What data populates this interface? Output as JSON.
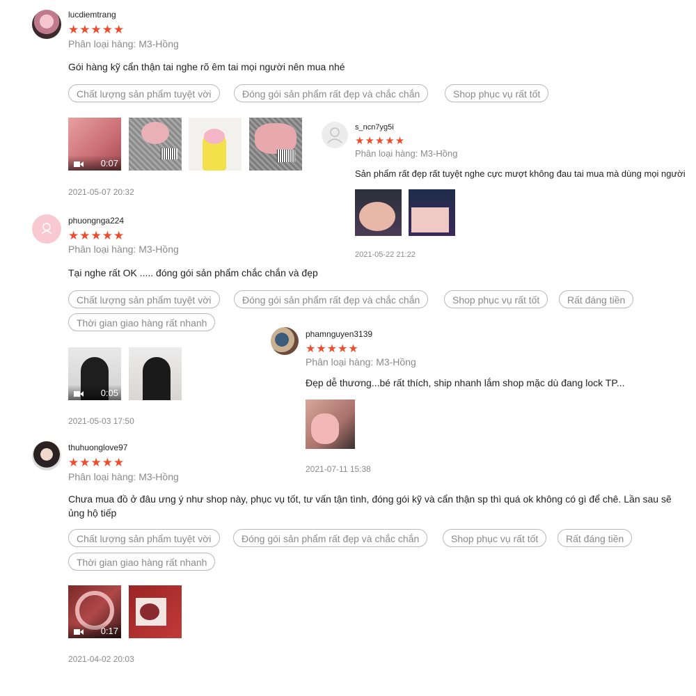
{
  "common": {
    "stars": "★★★★★",
    "star_color": "#ee4d2d"
  },
  "reviews": [
    {
      "username": "lucdiemtrang",
      "variant": "Phân loại hàng: M3-Hồng",
      "comment": "Gói hàng kỹ cẩn thận tai nghe rõ êm tai mọi người nên mua nhé",
      "tags": [
        "Chất lượng sản phẩm tuyệt vời",
        "Đóng gói sản phẩm rất đẹp và chắc chắn",
        "Shop phục vụ rất tốt"
      ],
      "video_duration": "0:07",
      "media_count": 4,
      "date": "2021-05-07 20:32"
    },
    {
      "username": "s_ncn7yg5i",
      "variant": "Phân loại hàng: M3-Hồng",
      "comment": "Sản phẩm rất đẹp rất tuyệt nghe cực mượt không đau tai mua mà dùng mọi người",
      "tags": [],
      "media_count": 2,
      "date": "2021-05-22 21:22"
    },
    {
      "username": "phuongnga224",
      "variant": "Phân loại hàng: M3-Hồng",
      "comment": "Tại nghe rất OK ..... đóng gói sản phẩm chắc chắn và đẹp",
      "tags": [
        "Chất lượng sản phẩm tuyệt vời",
        "Đóng gói sản phẩm rất đẹp và chắc chắn",
        "Shop phục vụ rất tốt",
        "Rất đáng tiền",
        "Thời gian giao hàng rất nhanh"
      ],
      "video_duration": "0:05",
      "media_count": 2,
      "date": "2021-05-03 17:50"
    },
    {
      "username": "phamnguyen3139",
      "variant": "Phân loại hàng: M3-Hồng",
      "comment": "Đẹp dễ thương...bé rất thích, ship nhanh lắm shop mặc dù đang lock TP...",
      "tags": [],
      "media_count": 1,
      "date": "2021-07-11 15:38"
    },
    {
      "username": "thuhuonglove97",
      "variant": "Phân loại hàng: M3-Hồng",
      "comment": "Chưa mua đồ ở đâu ưng ý như shop này, phục vụ tốt, tư vấn tận tình, đóng gói kỹ và cẩn thận sp thì quá ok không có gì để chê. Lần sau sẽ ủng hộ tiếp",
      "tags": [
        "Chất lượng sản phẩm tuyệt vời",
        "Đóng gói sản phẩm rất đẹp và chắc chắn",
        "Shop phục vụ rất tốt",
        "Rất đáng tiền",
        "Thời gian giao hàng rất nhanh"
      ],
      "video_duration": "0:17",
      "media_count": 2,
      "date": "2021-04-02 20:03"
    }
  ]
}
